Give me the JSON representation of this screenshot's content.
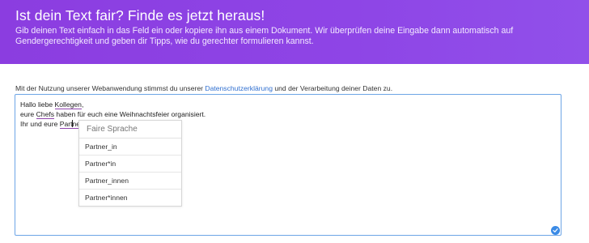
{
  "hero": {
    "title": "Ist dein Text fair? Finde es jetzt heraus!",
    "subtitle": "Gib deinen Text einfach in das Feld ein oder kopiere ihn aus einem Dokument. Wir überprüfen deine Eingabe dann automatisch auf Gendergerechtigkeit und geben dir Tipps, wie du gerechter formulieren kannst."
  },
  "consent": {
    "prefix": "Mit der Nutzung unserer Webanwendung stimmst du unserer ",
    "link": "Datenschutzerklärung",
    "suffix": " und der Verarbeitung deiner Daten zu."
  },
  "editor": {
    "line1": {
      "before": "Hallo liebe ",
      "flagged": "Kollegen",
      "after": ","
    },
    "line2": {
      "before": "eure ",
      "flagged": "Chefs",
      "after": " haben für euch eine Weihnachtsfeier organisiert."
    },
    "line3": {
      "before": "Ihr und eure ",
      "flagged_a": "Part",
      "flagged_b": "ner"
    }
  },
  "suggestions": {
    "header": "Faire Sprache",
    "items": [
      "Partner_in",
      "Partner*in",
      "Partner_innen",
      "Partner*innen"
    ]
  },
  "status_icon": "check-circle-icon",
  "colors": {
    "accent": "#8b3de0",
    "link": "#2f6fd0",
    "underline": "#8e44ad",
    "focus_border": "#6da5e6"
  }
}
